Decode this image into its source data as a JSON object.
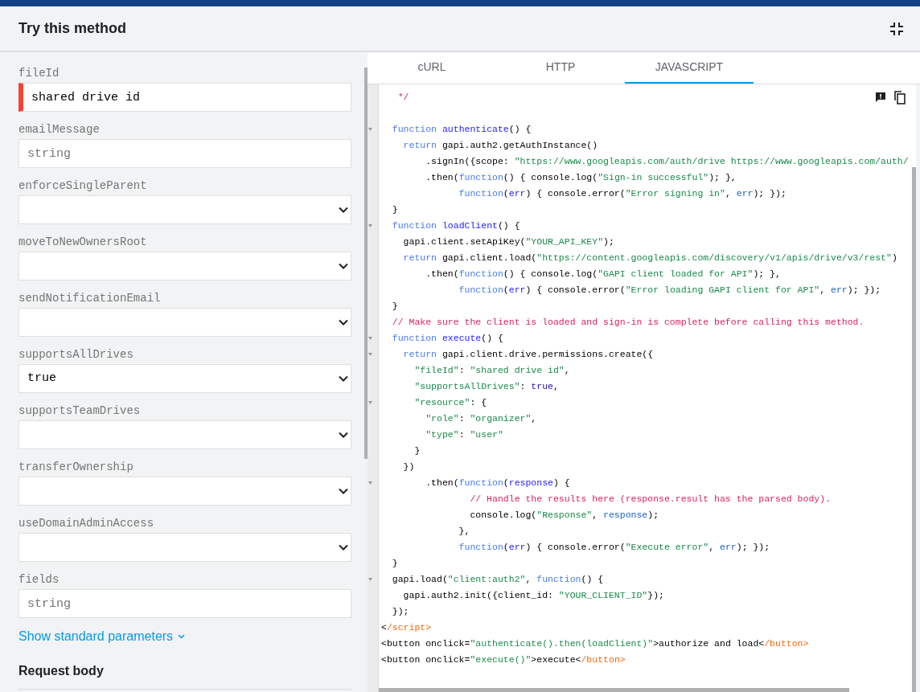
{
  "dialog": {
    "title": "Try this method"
  },
  "parameters": [
    {
      "label": "fileId",
      "kind": "input",
      "value": "shared drive id",
      "invalid": true
    },
    {
      "label": "emailMessage",
      "kind": "input",
      "placeholder": "string",
      "invalid": false
    },
    {
      "label": "enforceSingleParent",
      "kind": "select",
      "invalid": false
    },
    {
      "label": "moveToNewOwnersRoot",
      "kind": "select",
      "invalid": false
    },
    {
      "label": "sendNotificationEmail",
      "kind": "select",
      "invalid": false
    },
    {
      "label": "supportsAllDrives",
      "kind": "select",
      "value": "true",
      "invalid": false
    },
    {
      "label": "supportsTeamDrives",
      "kind": "select",
      "invalid": false
    },
    {
      "label": "transferOwnership",
      "kind": "select",
      "invalid": false
    },
    {
      "label": "useDomainAdminAccess",
      "kind": "select",
      "invalid": false
    },
    {
      "label": "fields",
      "kind": "input",
      "placeholder": "string",
      "invalid": false
    }
  ],
  "show_standard_parameters": "Show standard parameters",
  "request_body_heading": "Request body",
  "tabs": [
    {
      "label": "cURL",
      "selected": false
    },
    {
      "label": "HTTP",
      "selected": false
    },
    {
      "label": "JAVASCRIPT",
      "selected": true
    }
  ],
  "code": {
    "lines": [
      {
        "foldable": false,
        "tokens": [
          {
            "kind": "comment",
            "text": "   */"
          }
        ]
      },
      {
        "foldable": false
      },
      {
        "foldable": true,
        "tokens": [
          {
            "kind": "keyword",
            "text": "  function "
          },
          {
            "kind": "def",
            "text": "authenticate"
          },
          {
            "kind": "plain",
            "text": "() {"
          }
        ]
      },
      {
        "foldable": false,
        "tokens": [
          {
            "kind": "keyword",
            "text": "    return"
          },
          {
            "kind": "plain",
            "text": " gapi.auth2.getAuthInstance()"
          }
        ]
      },
      {
        "foldable": false,
        "tokens": [
          {
            "kind": "plain",
            "text": "        .signIn({scope: "
          },
          {
            "kind": "string",
            "text": "\"https://www.googleapis.com/auth/drive https://www.googleapis.com/auth/"
          }
        ]
      },
      {
        "foldable": false,
        "tokens": [
          {
            "kind": "plain",
            "text": "        .then("
          },
          {
            "kind": "keyword",
            "text": "function"
          },
          {
            "kind": "plain",
            "text": "() { console.log("
          },
          {
            "kind": "string",
            "text": "\"Sign-in successful\""
          },
          {
            "kind": "plain",
            "text": "); },"
          }
        ]
      },
      {
        "foldable": false,
        "tokens": [
          {
            "kind": "keyword",
            "text": "              function"
          },
          {
            "kind": "plain",
            "text": "("
          },
          {
            "kind": "def",
            "text": "err"
          },
          {
            "kind": "plain",
            "text": ") { console.error("
          },
          {
            "kind": "string",
            "text": "\"Error signing in\""
          },
          {
            "kind": "plain",
            "text": ", "
          },
          {
            "kind": "variable",
            "text": "err"
          },
          {
            "kind": "plain",
            "text": "); });"
          }
        ]
      },
      {
        "foldable": false,
        "tokens": [
          {
            "kind": "plain",
            "text": "  }"
          }
        ]
      },
      {
        "foldable": true,
        "tokens": [
          {
            "kind": "keyword",
            "text": "  function "
          },
          {
            "kind": "def",
            "text": "loadClient"
          },
          {
            "kind": "plain",
            "text": "() {"
          }
        ]
      },
      {
        "foldable": false,
        "tokens": [
          {
            "kind": "plain",
            "text": "    gapi.client.setApiKey("
          },
          {
            "kind": "string",
            "text": "\"YOUR_API_KEY\""
          },
          {
            "kind": "plain",
            "text": ");"
          }
        ]
      },
      {
        "foldable": false,
        "tokens": [
          {
            "kind": "keyword",
            "text": "    return"
          },
          {
            "kind": "plain",
            "text": " gapi.client.load("
          },
          {
            "kind": "string",
            "text": "\"https://content.googleapis.com/discovery/v1/apis/drive/v3/rest\""
          },
          {
            "kind": "plain",
            "text": ")"
          }
        ]
      },
      {
        "foldable": false,
        "tokens": [
          {
            "kind": "plain",
            "text": "        .then("
          },
          {
            "kind": "keyword",
            "text": "function"
          },
          {
            "kind": "plain",
            "text": "() { console.log("
          },
          {
            "kind": "string",
            "text": "\"GAPI client loaded for API\""
          },
          {
            "kind": "plain",
            "text": "); },"
          }
        ]
      },
      {
        "foldable": false,
        "tokens": [
          {
            "kind": "keyword",
            "text": "              function"
          },
          {
            "kind": "plain",
            "text": "("
          },
          {
            "kind": "def",
            "text": "err"
          },
          {
            "kind": "plain",
            "text": ") { console.error("
          },
          {
            "kind": "string",
            "text": "\"Error loading GAPI client for API\""
          },
          {
            "kind": "plain",
            "text": ", "
          },
          {
            "kind": "variable",
            "text": "err"
          },
          {
            "kind": "plain",
            "text": "); });"
          }
        ]
      },
      {
        "foldable": false,
        "tokens": [
          {
            "kind": "plain",
            "text": "  }"
          }
        ]
      },
      {
        "foldable": false,
        "tokens": [
          {
            "kind": "comment",
            "text": "  // Make sure the client is loaded and sign-in is complete before calling this method."
          }
        ]
      },
      {
        "foldable": true,
        "tokens": [
          {
            "kind": "keyword",
            "text": "  function "
          },
          {
            "kind": "def",
            "text": "execute"
          },
          {
            "kind": "plain",
            "text": "() {"
          }
        ]
      },
      {
        "foldable": true,
        "tokens": [
          {
            "kind": "keyword",
            "text": "    return"
          },
          {
            "kind": "plain",
            "text": " gapi.client.drive.permissions.create({"
          }
        ]
      },
      {
        "foldable": false,
        "tokens": [
          {
            "kind": "string",
            "text": "      \"fileId\""
          },
          {
            "kind": "plain",
            "text": ": "
          },
          {
            "kind": "string",
            "text": "\"shared drive id\""
          },
          {
            "kind": "plain",
            "text": ","
          }
        ]
      },
      {
        "foldable": false,
        "tokens": [
          {
            "kind": "string",
            "text": "      \"supportsAllDrives\""
          },
          {
            "kind": "plain",
            "text": ": "
          },
          {
            "kind": "atom",
            "text": "true"
          },
          {
            "kind": "plain",
            "text": ","
          }
        ]
      },
      {
        "foldable": true,
        "tokens": [
          {
            "kind": "string",
            "text": "      \"resource\""
          },
          {
            "kind": "plain",
            "text": ": {"
          }
        ]
      },
      {
        "foldable": false,
        "tokens": [
          {
            "kind": "string",
            "text": "        \"role\""
          },
          {
            "kind": "plain",
            "text": ": "
          },
          {
            "kind": "string",
            "text": "\"organizer\""
          },
          {
            "kind": "plain",
            "text": ","
          }
        ]
      },
      {
        "foldable": false,
        "tokens": [
          {
            "kind": "string",
            "text": "        \"type\""
          },
          {
            "kind": "plain",
            "text": ": "
          },
          {
            "kind": "string",
            "text": "\"user\""
          }
        ]
      },
      {
        "foldable": false,
        "tokens": [
          {
            "kind": "plain",
            "text": "      }"
          }
        ]
      },
      {
        "foldable": false,
        "tokens": [
          {
            "kind": "plain",
            "text": "    })"
          }
        ]
      },
      {
        "foldable": true,
        "tokens": [
          {
            "kind": "plain",
            "text": "        .then("
          },
          {
            "kind": "keyword",
            "text": "function"
          },
          {
            "kind": "plain",
            "text": "("
          },
          {
            "kind": "def",
            "text": "response"
          },
          {
            "kind": "plain",
            "text": ") {"
          }
        ]
      },
      {
        "foldable": false,
        "tokens": [
          {
            "kind": "comment",
            "text": "                // Handle the results here (response.result has the parsed body)."
          }
        ]
      },
      {
        "foldable": false,
        "tokens": [
          {
            "kind": "plain",
            "text": "                console.log("
          },
          {
            "kind": "string",
            "text": "\"Response\""
          },
          {
            "kind": "plain",
            "text": ", "
          },
          {
            "kind": "variable",
            "text": "response"
          },
          {
            "kind": "plain",
            "text": ");"
          }
        ]
      },
      {
        "foldable": false,
        "tokens": [
          {
            "kind": "plain",
            "text": "              },"
          }
        ]
      },
      {
        "foldable": false,
        "tokens": [
          {
            "kind": "keyword",
            "text": "              function"
          },
          {
            "kind": "plain",
            "text": "("
          },
          {
            "kind": "def",
            "text": "err"
          },
          {
            "kind": "plain",
            "text": ") { console.error("
          },
          {
            "kind": "string",
            "text": "\"Execute error\""
          },
          {
            "kind": "plain",
            "text": ", "
          },
          {
            "kind": "variable",
            "text": "err"
          },
          {
            "kind": "plain",
            "text": "); });"
          }
        ]
      },
      {
        "foldable": false,
        "tokens": [
          {
            "kind": "plain",
            "text": "  }"
          }
        ]
      },
      {
        "foldable": true,
        "tokens": [
          {
            "kind": "plain",
            "text": "  gapi.load("
          },
          {
            "kind": "string",
            "text": "\"client:auth2\""
          },
          {
            "kind": "plain",
            "text": ", "
          },
          {
            "kind": "keyword",
            "text": "function"
          },
          {
            "kind": "plain",
            "text": "() {"
          }
        ]
      },
      {
        "foldable": false,
        "tokens": [
          {
            "kind": "plain",
            "text": "    gapi.auth2.init({client_id: "
          },
          {
            "kind": "string",
            "text": "\"YOUR_CLIENT_ID\""
          },
          {
            "kind": "plain",
            "text": "});"
          }
        ]
      },
      {
        "foldable": false,
        "tokens": [
          {
            "kind": "plain",
            "text": "  });"
          }
        ]
      },
      {
        "foldable": false,
        "tokens": [
          {
            "kind": "plain",
            "text": "<"
          },
          {
            "kind": "tag",
            "text": "/script>"
          }
        ]
      },
      {
        "foldable": false,
        "tokens": [
          {
            "kind": "plain",
            "text": "<button onclick="
          },
          {
            "kind": "string",
            "text": "\"authenticate().then(loadClient)\""
          },
          {
            "kind": "plain",
            "text": ">authorize and load<"
          },
          {
            "kind": "tag",
            "text": "/button>"
          }
        ]
      },
      {
        "foldable": false,
        "tokens": [
          {
            "kind": "plain",
            "text": "<button onclick="
          },
          {
            "kind": "string",
            "text": "\"execute()\""
          },
          {
            "kind": "plain",
            "text": ">execute<"
          },
          {
            "kind": "tag",
            "text": "/button>"
          }
        ]
      }
    ]
  }
}
